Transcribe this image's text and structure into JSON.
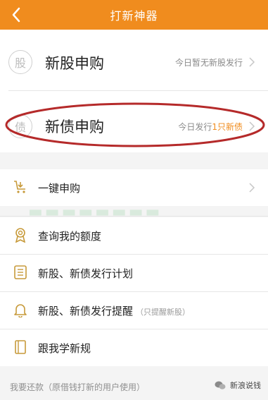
{
  "header": {
    "title": "打新神器"
  },
  "top_cards": [
    {
      "circle_char": "股",
      "title": "新股申购",
      "note_prefix": "今日暂无新股发行",
      "note_highlight": "",
      "note_suffix": ""
    },
    {
      "circle_char": "债",
      "title": "新债申购",
      "note_prefix": "今日发行",
      "note_highlight": "1只新债",
      "note_suffix": ""
    }
  ],
  "list": [
    {
      "label": "一键申购",
      "sub": "",
      "icon": "cart-icon"
    },
    {
      "label": "查询我的额度",
      "sub": "",
      "icon": "badge-icon"
    },
    {
      "label": "新股、新债发行计划",
      "sub": "",
      "icon": "list-icon"
    },
    {
      "label": "新股、新债发行提醒",
      "sub": "（只提醒新股）",
      "icon": "bell-icon"
    },
    {
      "label": "跟我学新规",
      "sub": "",
      "icon": "book-icon"
    }
  ],
  "footer": {
    "text": "我要还款（原借钱打新的用户使用）"
  },
  "watermark": {
    "text": "新浪说钱"
  },
  "colors": {
    "accent": "#f08c1e",
    "highlight_ring": "#b52a2a"
  }
}
